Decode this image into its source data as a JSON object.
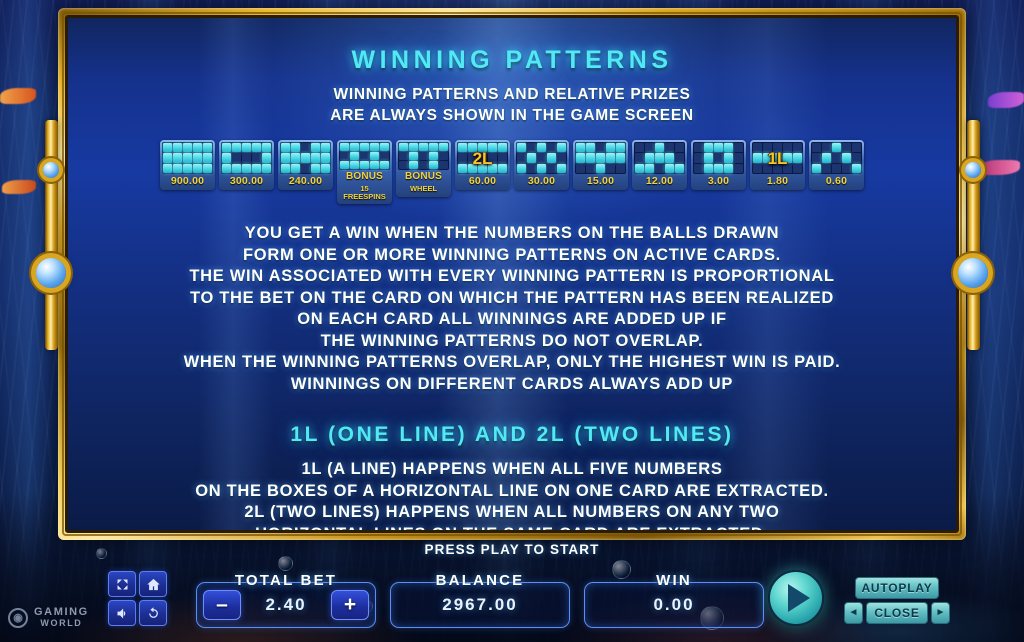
{
  "panel": {
    "heading": "WINNING PATTERNS",
    "subtitle": [
      "WINNING PATTERNS AND RELATIVE PRIZES",
      "ARE ALWAYS SHOWN IN THE GAME SCREEN"
    ],
    "body": [
      "YOU GET A WIN WHEN THE NUMBERS ON THE BALLS DRAWN",
      "FORM ONE OR MORE WINNING PATTERNS ON ACTIVE CARDS.",
      "THE WIN ASSOCIATED WITH EVERY WINNING PATTERN IS PROPORTIONAL",
      "TO THE BET ON THE CARD ON WHICH THE PATTERN HAS BEEN REALIZED",
      "ON EACH CARD ALL WINNINGS ARE ADDED UP IF",
      "THE WINNING PATTERNS DO NOT OVERLAP.",
      "WHEN THE WINNING PATTERNS OVERLAP, ONLY THE HIGHEST WIN IS PAID.",
      "WINNINGS ON DIFFERENT CARDS ALWAYS ADD UP"
    ],
    "heading2": "1L (ONE LINE) AND 2L (TWO LINES)",
    "body2": [
      "1L (A LINE) HAPPENS WHEN ALL FIVE NUMBERS",
      "ON THE BOXES OF A HORIZONTAL LINE ON ONE CARD ARE EXTRACTED.",
      "2L (TWO LINES) HAPPENS WHEN ALL NUMBERS ON ANY TWO",
      "HORIZONTAL LINES ON THE SAME CARD ARE EXTRACTED."
    ]
  },
  "tiles": [
    {
      "name": "pattern-full-card",
      "label": "900.00",
      "overlay": "",
      "sub": "",
      "cells": [
        1,
        1,
        1,
        1,
        1,
        1,
        1,
        1,
        1,
        1,
        1,
        1,
        1,
        1,
        1
      ]
    },
    {
      "name": "pattern-frame",
      "label": "300.00",
      "overlay": "",
      "sub": "",
      "cells": [
        1,
        1,
        1,
        1,
        1,
        1,
        0,
        0,
        0,
        1,
        1,
        1,
        1,
        1,
        1
      ]
    },
    {
      "name": "pattern-h-shape",
      "label": "240.00",
      "overlay": "",
      "sub": "",
      "cells": [
        1,
        1,
        0,
        1,
        1,
        1,
        1,
        1,
        1,
        1,
        1,
        1,
        0,
        1,
        1
      ]
    },
    {
      "name": "pattern-bonus-freespins",
      "label": "BONUS",
      "overlay": "",
      "sub": "15 FREESPINS",
      "cells": [
        1,
        1,
        1,
        1,
        1,
        0,
        1,
        0,
        1,
        0,
        1,
        1,
        1,
        1,
        1
      ]
    },
    {
      "name": "pattern-bonus-wheel",
      "label": "BONUS",
      "overlay": "",
      "sub": "WHEEL",
      "cells": [
        1,
        1,
        1,
        1,
        1,
        0,
        1,
        0,
        1,
        0,
        0,
        1,
        0,
        1,
        0
      ]
    },
    {
      "name": "pattern-two-lines",
      "label": "60.00",
      "overlay": "2L",
      "sub": "",
      "cells": [
        1,
        1,
        1,
        1,
        1,
        0,
        0,
        0,
        0,
        0,
        1,
        1,
        1,
        1,
        1
      ]
    },
    {
      "name": "pattern-checkerboard",
      "label": "30.00",
      "overlay": "",
      "sub": "",
      "cells": [
        1,
        0,
        1,
        0,
        1,
        0,
        1,
        0,
        1,
        0,
        1,
        0,
        1,
        0,
        1
      ]
    },
    {
      "name": "pattern-t-cross",
      "label": "15.00",
      "overlay": "",
      "sub": "",
      "cells": [
        1,
        1,
        0,
        1,
        1,
        1,
        1,
        1,
        1,
        1,
        0,
        0,
        1,
        0,
        0
      ]
    },
    {
      "name": "pattern-arrow",
      "label": "12.00",
      "overlay": "",
      "sub": "",
      "cells": [
        0,
        0,
        1,
        0,
        0,
        0,
        1,
        1,
        1,
        0,
        1,
        1,
        0,
        1,
        1
      ]
    },
    {
      "name": "pattern-center-box",
      "label": "3.00",
      "overlay": "",
      "sub": "",
      "cells": [
        0,
        1,
        1,
        1,
        0,
        0,
        1,
        0,
        1,
        0,
        0,
        1,
        1,
        1,
        0
      ]
    },
    {
      "name": "pattern-one-line",
      "label": "1.80",
      "overlay": "1L",
      "sub": "",
      "cells": [
        0,
        0,
        0,
        0,
        0,
        1,
        1,
        1,
        1,
        1,
        0,
        0,
        0,
        0,
        0
      ]
    },
    {
      "name": "pattern-scatter",
      "label": "0.60",
      "overlay": "",
      "sub": "",
      "cells": [
        0,
        0,
        1,
        0,
        0,
        0,
        1,
        0,
        1,
        0,
        1,
        0,
        0,
        0,
        1
      ]
    }
  ],
  "bottom": {
    "press_play": "PRESS PLAY TO START",
    "total_bet": {
      "label": "TOTAL BET",
      "value": "2.40",
      "minus": "–",
      "plus": "+"
    },
    "balance": {
      "label": "BALANCE",
      "value": "2967.00"
    },
    "win": {
      "label": "WIN",
      "value": "0.00"
    },
    "autoplay_label": "AUTOPLAY",
    "close_label": "CLOSE",
    "arrow_left": "◄",
    "arrow_right": "►"
  },
  "brand": {
    "line1": "GAMING",
    "line2": "WORLD",
    "mark": "◉"
  },
  "colors": {
    "heading_cyan": "#52e8f6",
    "gold": "#f3d23a",
    "tile_on": "#45d6e4",
    "panel_border_gold": "#e8b52a",
    "play_teal": "#5ed6cf",
    "button_teal": "#63bfc3"
  }
}
